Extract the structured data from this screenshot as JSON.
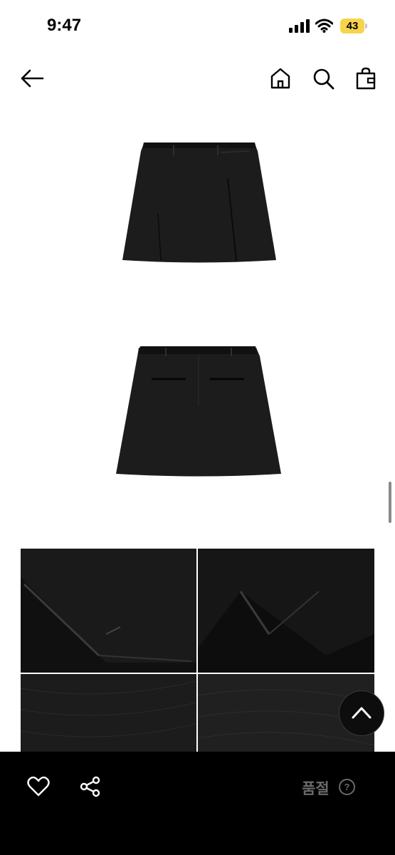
{
  "status": {
    "time": "9:47",
    "battery": "43"
  },
  "nav": {
    "back_icon": "arrow-left-icon",
    "home_icon": "home-icon",
    "search_icon": "search-icon",
    "bag_icon": "shopping-bag-icon"
  },
  "product_images": [
    {
      "name": "skirt-front-view"
    },
    {
      "name": "skirt-back-view"
    },
    {
      "name": "detail-hem"
    },
    {
      "name": "detail-slit"
    },
    {
      "name": "fabric-texture-1"
    },
    {
      "name": "fabric-texture-2"
    }
  ],
  "scroll_top_icon": "chevron-up-icon",
  "bottom_bar": {
    "like_icon": "heart-icon",
    "share_icon": "share-icon",
    "status_label": "품절",
    "help_icon_label": "?"
  },
  "colors": {
    "bottom_bar_bg": "#000000",
    "status_label_color": "#6a6a6a",
    "battery_badge": "#f7d44c"
  }
}
